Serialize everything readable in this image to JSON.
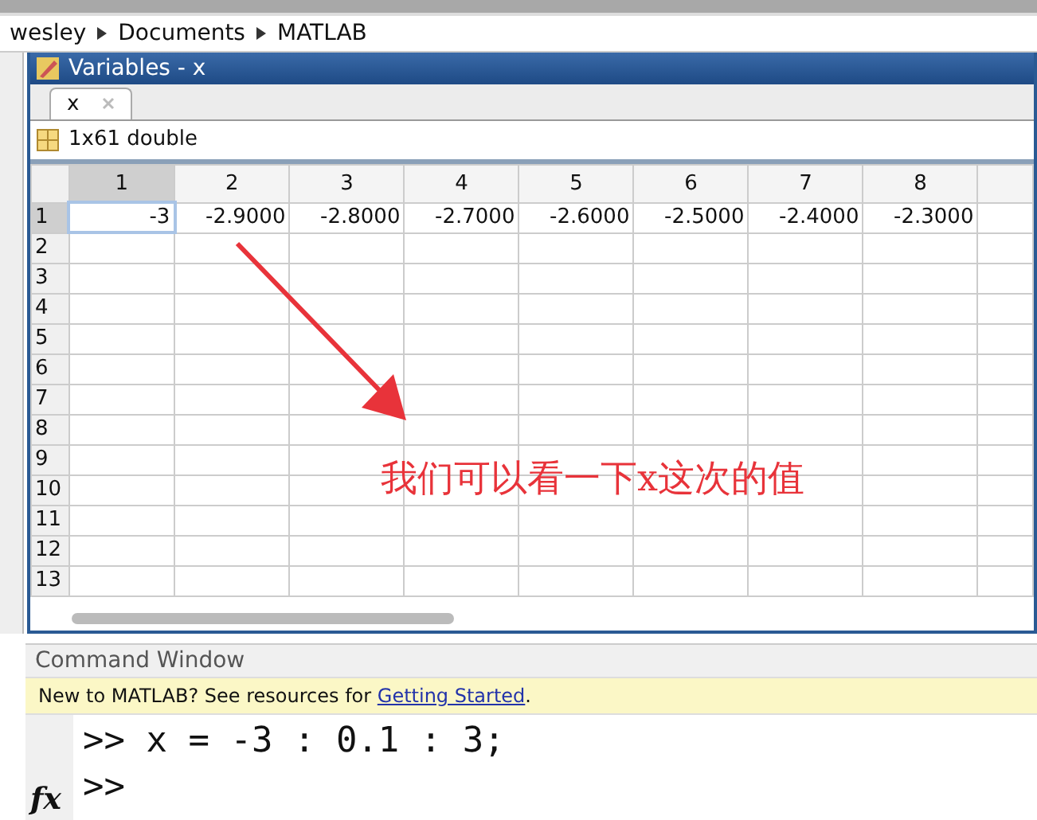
{
  "breadcrumb": [
    "wesley",
    "Documents",
    "MATLAB"
  ],
  "variables_window": {
    "title": "Variables - x",
    "tabs": [
      {
        "label": "x",
        "selected": true
      }
    ],
    "info": "1x61 double",
    "columns": [
      "1",
      "2",
      "3",
      "4",
      "5",
      "6",
      "7",
      "8"
    ],
    "rows": [
      {
        "label": "1",
        "cells": [
          "-3",
          "-2.9000",
          "-2.8000",
          "-2.7000",
          "-2.6000",
          "-2.5000",
          "-2.4000",
          "-2.3000"
        ]
      },
      {
        "label": "2",
        "cells": []
      },
      {
        "label": "3",
        "cells": []
      },
      {
        "label": "4",
        "cells": []
      },
      {
        "label": "5",
        "cells": []
      },
      {
        "label": "6",
        "cells": []
      },
      {
        "label": "7",
        "cells": []
      },
      {
        "label": "8",
        "cells": []
      },
      {
        "label": "9",
        "cells": []
      },
      {
        "label": "10",
        "cells": []
      },
      {
        "label": "11",
        "cells": []
      },
      {
        "label": "12",
        "cells": []
      },
      {
        "label": "13",
        "cells": []
      }
    ]
  },
  "annotation": "我们可以看一下x这次的值",
  "command_window": {
    "title": "Command Window",
    "notice": "New to MATLAB? See resources for ",
    "notice_link": "Getting Started",
    "notice_end": ".",
    "lines": [
      ">> x = -3 : 0.1 : 3;",
      ">>"
    ],
    "fx": "fx"
  }
}
